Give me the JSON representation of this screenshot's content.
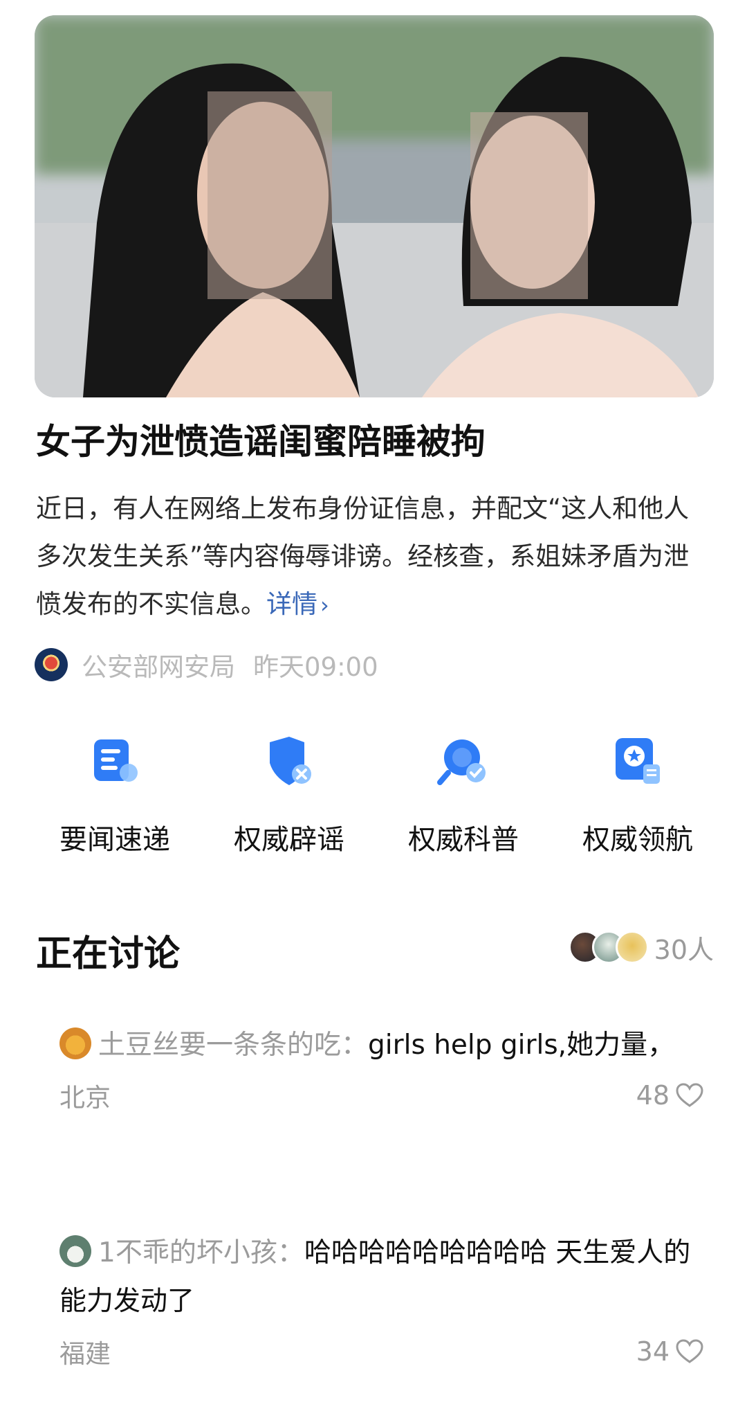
{
  "article": {
    "image_alt": "两名女子面对面的照片（面部已打码）",
    "headline": "女子为泄愤造谣闺蜜陪睡被拘",
    "summary": "近日，有人在网络上发布身份证信息，并配文“这人和他人多次发生关系”等内容侮辱诽谤。经核查，系姐妹矛盾为泄愤发布的不实信息。",
    "detail_label": "详情",
    "detail_chevron": "›",
    "source_name": "公安部网安局",
    "time": "昨天09:00"
  },
  "shortcuts": [
    {
      "label": "要闻速递",
      "icon": "news-doc-icon"
    },
    {
      "label": "权威辟谣",
      "icon": "shield-x-icon"
    },
    {
      "label": "权威科普",
      "icon": "magnifier-check-icon"
    },
    {
      "label": "权威领航",
      "icon": "badge-star-icon"
    }
  ],
  "discussion": {
    "title": "正在讨论",
    "participants": "30人",
    "comments": [
      {
        "user": "土豆丝要一条条的吃：",
        "text": "girls help girls,她力量，",
        "location": "北京",
        "likes": "48"
      },
      {
        "user": "1不乖的坏小孩：",
        "text": "哈哈哈哈哈哈哈哈哈 天生爱人的能力发动了",
        "location": "福建",
        "likes": "34"
      }
    ]
  },
  "colors": {
    "accent": "#2f7cf6",
    "link": "#3a68b8",
    "muted": "#9b9b9b"
  }
}
